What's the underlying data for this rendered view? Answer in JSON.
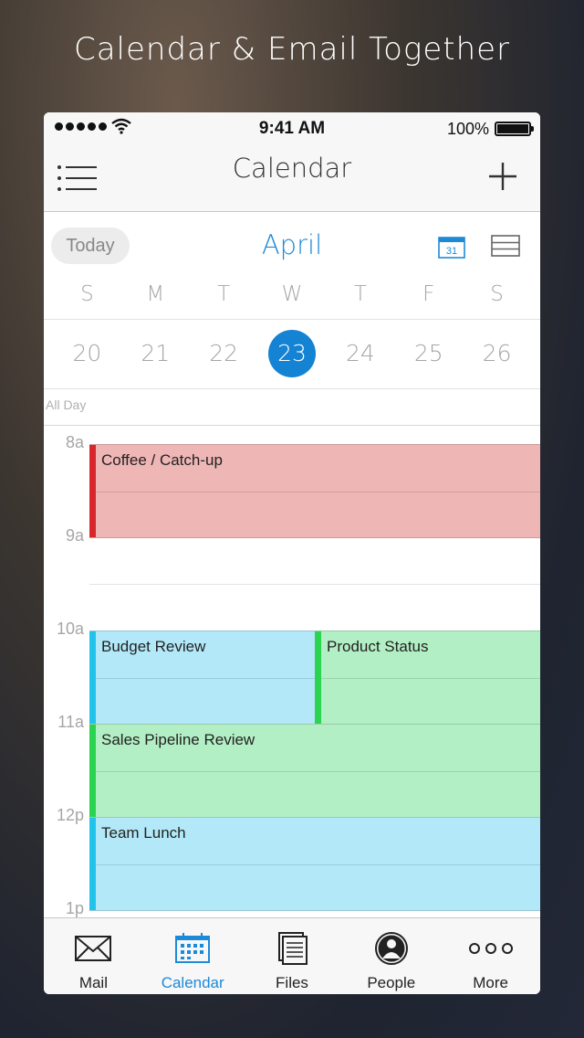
{
  "promo": {
    "title": "Calendar & Email Together"
  },
  "status_bar": {
    "time": "9:41 AM",
    "battery": "100%"
  },
  "nav": {
    "title": "Calendar"
  },
  "header": {
    "today_label": "Today",
    "month": "April",
    "calendar_icon_day": "31"
  },
  "weekdays": [
    "S",
    "M",
    "T",
    "W",
    "T",
    "F",
    "S"
  ],
  "dates": [
    "20",
    "21",
    "22",
    "23",
    "24",
    "25",
    "26"
  ],
  "selected_date": "23",
  "all_day_label": "All Day",
  "hours": [
    "8a",
    "9a",
    "10a",
    "11a",
    "12p",
    "1p"
  ],
  "events": [
    {
      "title": "Coffee / Catch-up",
      "start": "8a",
      "end": "9a",
      "color": "#efb6b6",
      "accent": "#d8262d"
    },
    {
      "title": "Budget Review",
      "start": "10a",
      "end": "11a",
      "color": "#b2e8f7",
      "accent": "#22c3ea"
    },
    {
      "title": "Product Status",
      "start": "10a",
      "end": "11a",
      "color": "#b3efc4",
      "accent": "#2bd44f"
    },
    {
      "title": "Sales Pipeline Review",
      "start": "11a",
      "end": "12p",
      "color": "#b3efc4",
      "accent": "#2bd44f"
    },
    {
      "title": "Team Lunch",
      "start": "12p",
      "end": "1p",
      "color": "#b2e8f7",
      "accent": "#22c3ea"
    }
  ],
  "tabs": [
    {
      "label": "Mail",
      "icon": "envelope-icon"
    },
    {
      "label": "Calendar",
      "icon": "calendar-grid-icon",
      "active": true
    },
    {
      "label": "Files",
      "icon": "files-icon"
    },
    {
      "label": "People",
      "icon": "person-icon"
    },
    {
      "label": "More",
      "icon": "ellipsis-icon"
    }
  ],
  "colors": {
    "accent": "#1d8ad8",
    "selected_date_bg": "#1483d4"
  }
}
